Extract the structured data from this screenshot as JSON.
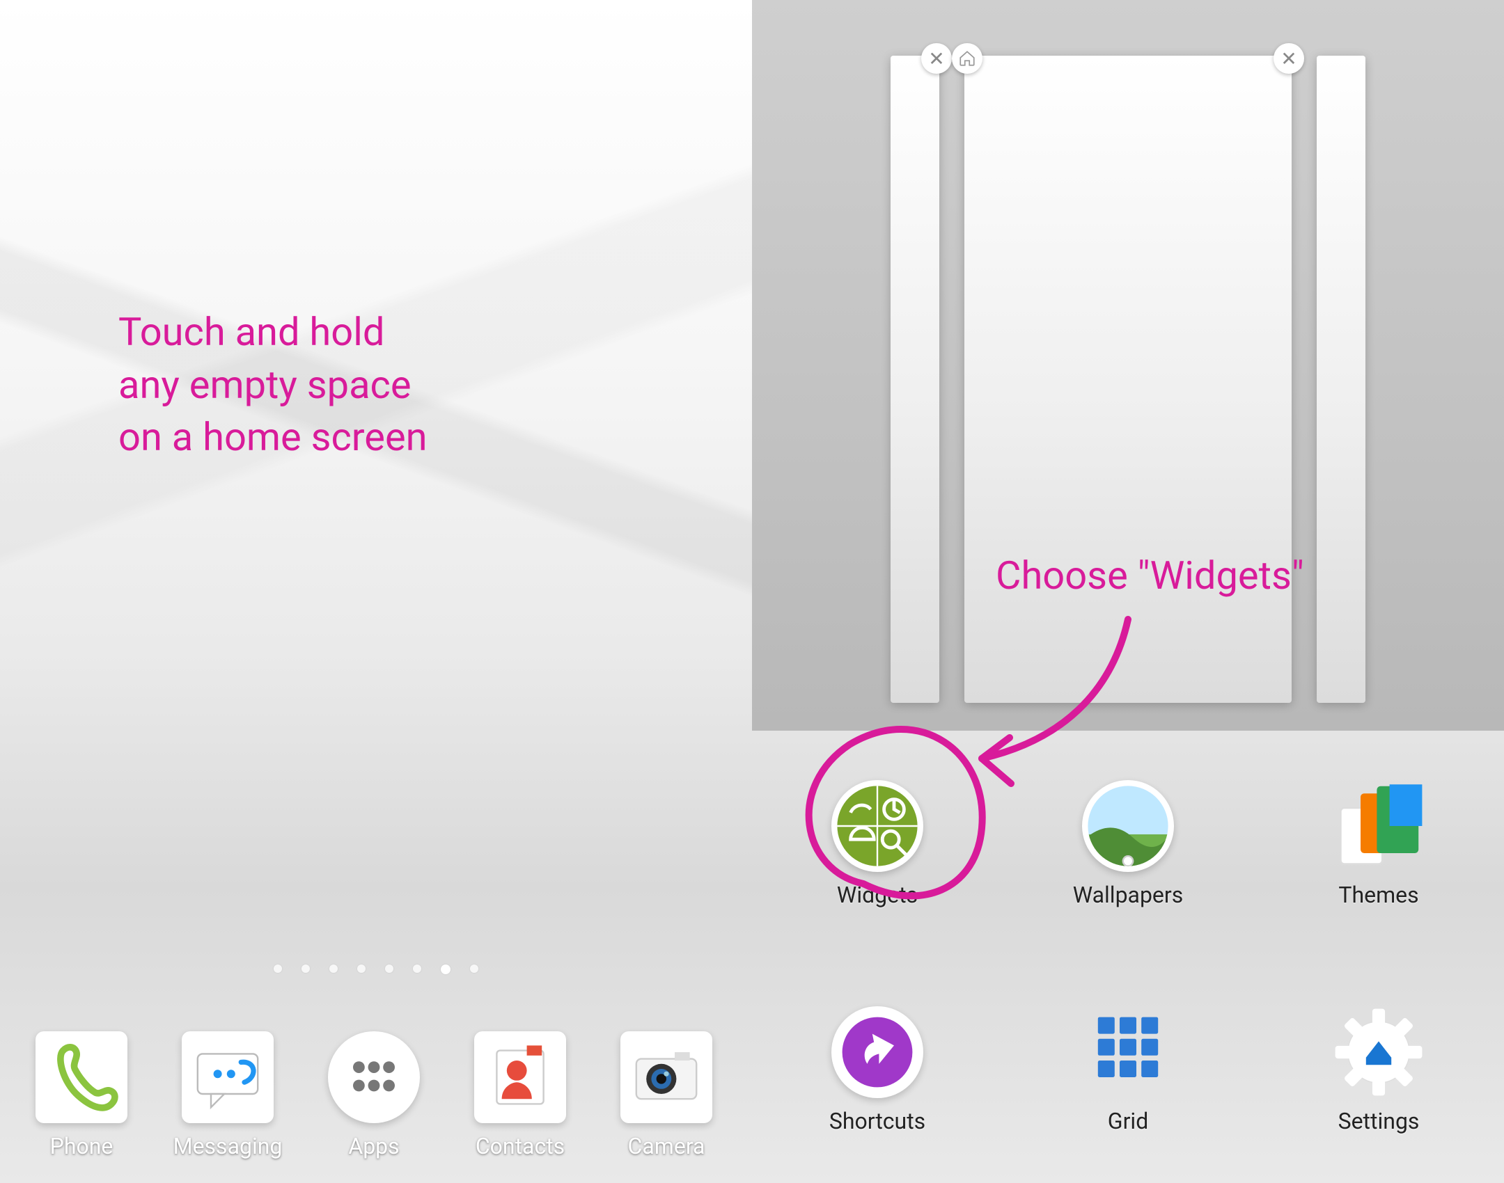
{
  "colors": {
    "accent": "#d81b9a"
  },
  "left": {
    "callout": "Touch and hold\nany empty space\non a home screen",
    "page_indicator": {
      "count": 8,
      "active_index": 6
    },
    "dock": [
      {
        "name": "phone",
        "label": "Phone"
      },
      {
        "name": "messaging",
        "label": "Messaging"
      },
      {
        "name": "apps",
        "label": "Apps"
      },
      {
        "name": "contacts",
        "label": "Contacts"
      },
      {
        "name": "camera",
        "label": "Camera"
      }
    ]
  },
  "right": {
    "callout": "Choose \"Widgets\"",
    "overview": {
      "thumbnails": [
        {
          "position": "left-peek",
          "close_visible": true,
          "is_home": false
        },
        {
          "position": "center",
          "close_visible": true,
          "is_home": true
        },
        {
          "position": "right-peek",
          "close_visible": false,
          "is_home": false
        }
      ]
    },
    "menu": [
      {
        "name": "widgets",
        "label": "Widgets",
        "highlighted": true
      },
      {
        "name": "wallpapers",
        "label": "Wallpapers",
        "highlighted": false
      },
      {
        "name": "themes",
        "label": "Themes",
        "highlighted": false
      },
      {
        "name": "shortcuts",
        "label": "Shortcuts",
        "highlighted": false
      },
      {
        "name": "grid",
        "label": "Grid",
        "highlighted": false
      },
      {
        "name": "settings",
        "label": "Settings",
        "highlighted": false
      }
    ]
  }
}
